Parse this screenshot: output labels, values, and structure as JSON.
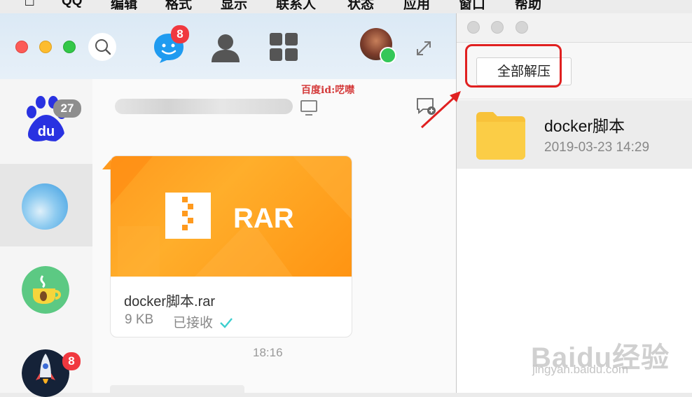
{
  "menubar": {
    "apple_icon": "apple-icon",
    "items": [
      "QQ",
      "编辑",
      "格式",
      "显示",
      "联系人",
      "状态",
      "应用",
      "窗口",
      "帮助"
    ]
  },
  "qq": {
    "message_badge": "8",
    "contacts": [
      {
        "name": "baidu-contact",
        "badge": "27"
      },
      {
        "name": "sky-contact",
        "badge": ""
      },
      {
        "name": "coffee-contact",
        "badge": ""
      },
      {
        "name": "rocket-contact",
        "badge": "8"
      }
    ],
    "message": {
      "file_type": "RAR",
      "file_name": "docker脚本.rar",
      "file_size": "9 KB",
      "status": "已接收"
    },
    "timestamp": "18:16"
  },
  "archive": {
    "extract_all_label": "全部解压",
    "entries": [
      {
        "name": "docker脚本",
        "date": "2019-03-23 14:29"
      }
    ]
  },
  "watermark": {
    "caption": "百度id:呓噤",
    "logo_text": "Baidu经验",
    "url": "jingyan.baidu.com"
  },
  "colors": {
    "rar_orange": "#ff9a1e",
    "badge_red": "#f0383f",
    "badge_grey": "#8e8e8e",
    "highlight_red": "#e02020",
    "received_check": "#3ccfcf"
  }
}
